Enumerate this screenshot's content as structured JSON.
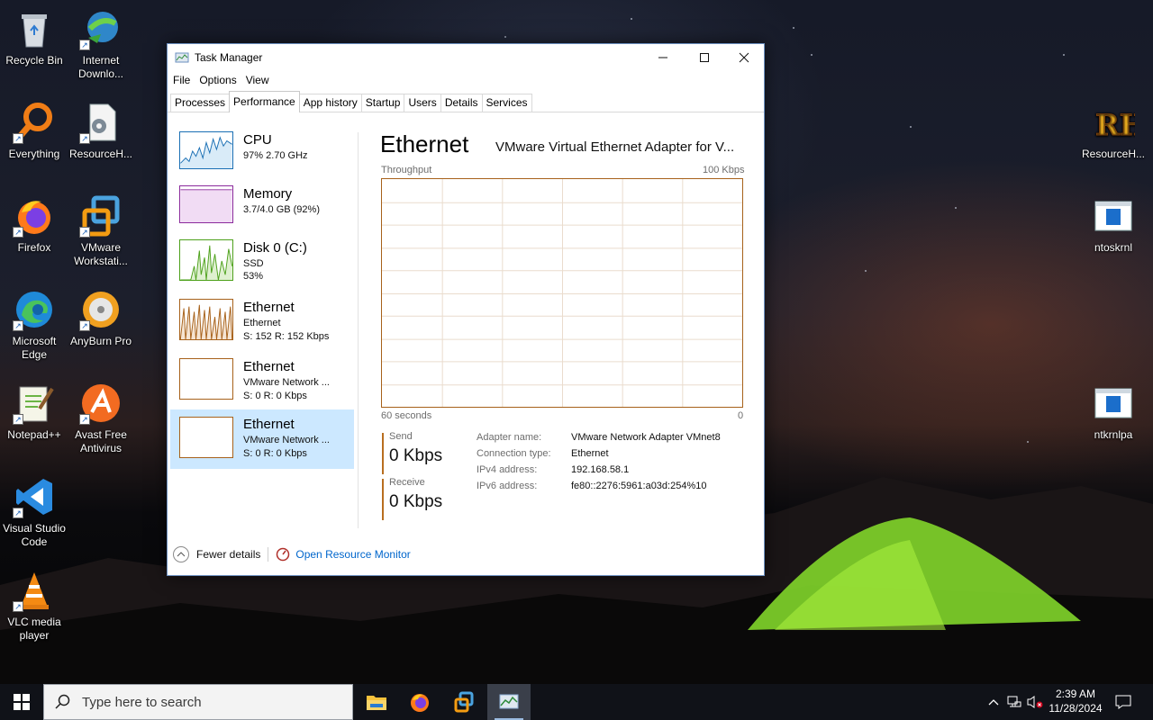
{
  "desktop": {
    "icons_left": [
      {
        "label": "Recycle Bin",
        "icon": "recycle-bin-icon"
      },
      {
        "label": "Internet Downlo...",
        "icon": "idm-icon"
      },
      {
        "label": "Everything",
        "icon": "everything-search-icon"
      },
      {
        "label": "ResourceH...",
        "icon": "resource-hacker-icon"
      },
      {
        "label": "Firefox",
        "icon": "firefox-icon"
      },
      {
        "label": "VMware Workstati...",
        "icon": "vmware-icon"
      },
      {
        "label": "Microsoft Edge",
        "icon": "edge-icon"
      },
      {
        "label": "AnyBurn Pro",
        "icon": "anyburn-icon"
      },
      {
        "label": "Notepad++",
        "icon": "notepadpp-icon"
      },
      {
        "label": "Avast Free Antivirus",
        "icon": "avast-icon"
      },
      {
        "label": "Visual Studio Code",
        "icon": "vscode-icon"
      },
      {
        "label": "VLC media player",
        "icon": "vlc-icon"
      }
    ],
    "icons_right": [
      {
        "label": "ResourceH...",
        "icon": "resource-hacker-icon"
      },
      {
        "label": "ntoskrnl",
        "icon": "exe-file-icon"
      },
      {
        "label": "ntkrnlpa",
        "icon": "exe-file-icon"
      }
    ]
  },
  "window": {
    "title": "Task Manager",
    "menu": [
      "File",
      "Options",
      "View"
    ],
    "tabs": [
      "Processes",
      "Performance",
      "App history",
      "Startup",
      "Users",
      "Details",
      "Services"
    ],
    "active_tab": "Performance"
  },
  "sidebar": [
    {
      "name": "CPU",
      "line1": "97%  2.70 GHz",
      "line2": "",
      "color": "#1a6fb4"
    },
    {
      "name": "Memory",
      "line1": "3.7/4.0 GB (92%)",
      "line2": "",
      "color": "#8b2a9c"
    },
    {
      "name": "Disk 0 (C:)",
      "line1": "SSD",
      "line2": "53%",
      "color": "#4da11b"
    },
    {
      "name": "Ethernet",
      "line1": "Ethernet",
      "line2": "S: 152  R: 152 Kbps",
      "color": "#a7611a"
    },
    {
      "name": "Ethernet",
      "line1": "VMware Network ...",
      "line2": "S: 0  R: 0 Kbps",
      "color": "#a7611a"
    },
    {
      "name": "Ethernet",
      "line1": "VMware Network ...",
      "line2": "S: 0  R: 0 Kbps",
      "color": "#a7611a",
      "selected": true
    }
  ],
  "main": {
    "title": "Ethernet",
    "adapter": "VMware Virtual Ethernet Adapter for V...",
    "graph_label": "Throughput",
    "graph_max": "100 Kbps",
    "graph_time": "60 seconds",
    "graph_min": "0",
    "send_label": "Send",
    "send_value": "0 Kbps",
    "receive_label": "Receive",
    "receive_value": "0 Kbps",
    "details": [
      {
        "key": "Adapter name:",
        "value": "VMware Network Adapter VMnet8"
      },
      {
        "key": "Connection type:",
        "value": "Ethernet"
      },
      {
        "key": "IPv4 address:",
        "value": "192.168.58.1"
      },
      {
        "key": "IPv6 address:",
        "value": "fe80::2276:5961:a03d:254%10"
      }
    ]
  },
  "footer": {
    "fewer_details": "Fewer details",
    "open_resource_monitor": "Open Resource Monitor"
  },
  "taskbar": {
    "search_placeholder": "Type here to search",
    "time": "2:39 AM",
    "date": "11/28/2024"
  }
}
